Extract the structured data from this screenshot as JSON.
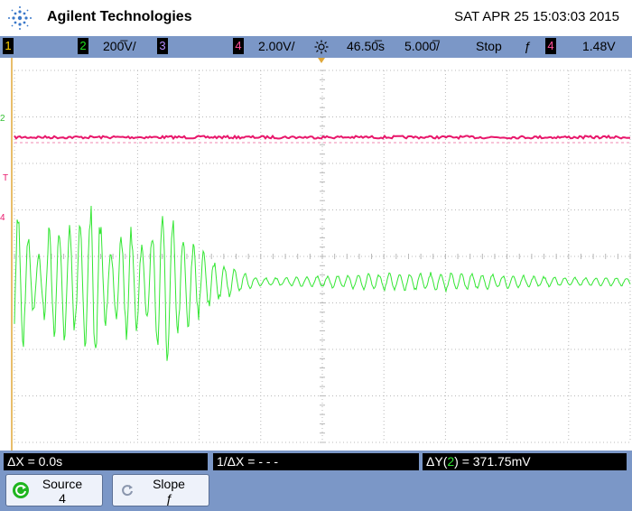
{
  "header": {
    "brand": "Agilent Technologies",
    "datetime": "SAT APR 25 15:03:03 2015"
  },
  "status_bar": {
    "ch1_label": "1",
    "ch2_label": "2",
    "ch2_scale": "200̅V/",
    "ch3_label": "3",
    "ch4_label": "4",
    "ch4_scale": "2.00V/",
    "trigger_pos_icon": "sun-icon",
    "time_offset": "46.50̅s",
    "time_scale": "5.000̅/",
    "run_state": "Stop",
    "slope_symbol": "ƒ",
    "trigger_source": "4",
    "trigger_level": "1.48V",
    "colors": {
      "ch1": "#ffd200",
      "ch2": "#1fe01f",
      "ch3": "#7a3fd0",
      "ch4": "#e8176b"
    }
  },
  "screen": {
    "markers": {
      "ch2_marker": "2",
      "trigger_marker": "T",
      "ch4_marker": "4"
    },
    "traces": {
      "ch4_color": "#e8176b",
      "ch2_color": "#33e633"
    }
  },
  "measurements": {
    "delta_x": "ΔX = 0.0s",
    "inverse_delta_x": "1/ΔX = - - -",
    "delta_y_prefix": "ΔY(",
    "delta_y_channel": "2",
    "delta_y_suffix": ") = 371.75mV"
  },
  "softkeys": [
    {
      "label": "Source",
      "value": "4",
      "icon": "rotate-icon"
    },
    {
      "label": "Slope",
      "value": "ƒ",
      "icon": "rotate-icon"
    }
  ]
}
